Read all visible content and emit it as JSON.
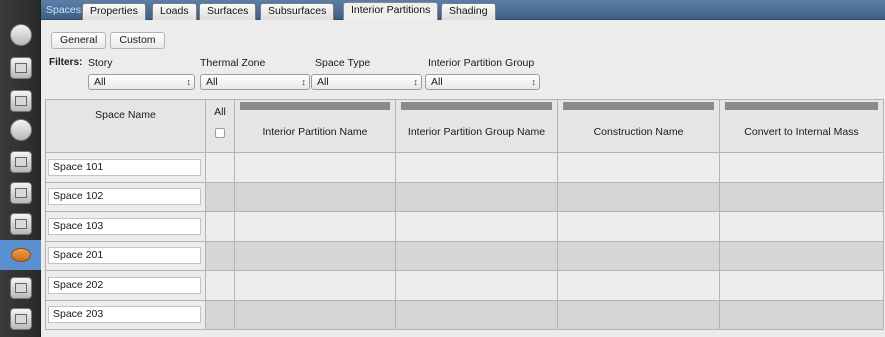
{
  "top_tabs": {
    "section": "Spaces",
    "items": [
      "Properties",
      "Loads",
      "Surfaces",
      "Subsurfaces",
      "Interior Partitions",
      "Shading"
    ],
    "selected": "Interior Partitions"
  },
  "subtabs": [
    "General",
    "Custom"
  ],
  "filters": {
    "label": "Filters:",
    "story": {
      "label": "Story",
      "value": "All"
    },
    "thermal_zone": {
      "label": "Thermal Zone",
      "value": "All"
    },
    "space_type": {
      "label": "Space Type",
      "value": "All"
    },
    "interior_partition_group": {
      "label": "Interior Partition Group",
      "value": "All"
    }
  },
  "grid": {
    "headers": {
      "space_name": "Space Name",
      "all": "All",
      "interior_partition_name": "Interior Partition Name",
      "interior_partition_group_name": "Interior Partition Group Name",
      "construction_name": "Construction Name",
      "convert_to_internal_mass": "Convert to Internal Mass"
    },
    "rows": [
      "Space 101",
      "Space 102",
      "Space 103",
      "Space 201",
      "Space 202",
      "Space 203"
    ]
  },
  "rail_icons": [
    "site-icon",
    "schedules-icon",
    "constructions-icon",
    "loads-icon",
    "space-types-icon",
    "geometry-icon",
    "facility-icon",
    "spaces-icon",
    "thermal-zones-icon",
    "hvac-systems-icon"
  ],
  "colors": {
    "accent": "#5a8fd0",
    "tabbar": "#4a6c95"
  }
}
